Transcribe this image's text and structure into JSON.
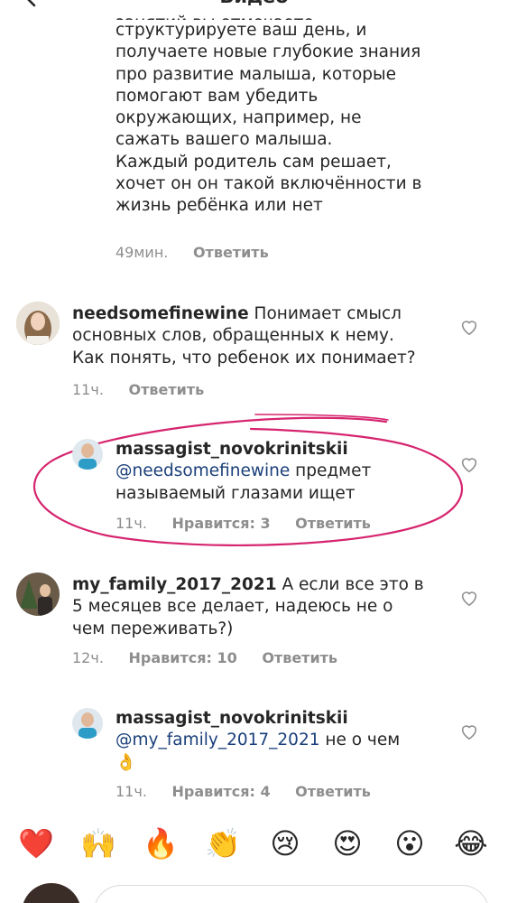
{
  "header": {
    "title": "Видео"
  },
  "previous_comment": {
    "lines": [
      "занятий вы отмечаете",
      "структурируете ваш день, и",
      "получаете новые глубокие знания",
      "про развитие малыша, которые",
      "помогают вам убедить",
      "окружающих, например, не",
      "сажать вашего малыша.",
      "Каждый родитель сам решает,",
      "хочет он он такой включённости в",
      "жизнь ребёнка или нет"
    ],
    "time": "49мин.",
    "reply": "Ответить"
  },
  "comments": [
    {
      "user": "needsomefinewine",
      "lines": [
        "Понимает смысл",
        "основных слов, обращенных к нему.",
        "Как понять, что ребенок их понимает?"
      ],
      "time": "11ч.",
      "reply": "Ответить"
    },
    {
      "user": "massagist_novokrinitskii",
      "mention": "@needsomefinewine",
      "lines": [
        "предмет",
        "называемый глазами ищет"
      ],
      "time": "11ч.",
      "likes": "Нравится: 3",
      "reply": "Ответить"
    },
    {
      "user": "my_family_2017_2021",
      "lines": [
        "А если все это в",
        "5 месяцев все делает, надеюсь не о",
        "чем переживать?)"
      ],
      "time": "12ч.",
      "likes": "Нравится: 10",
      "reply": "Ответить"
    },
    {
      "user": "massagist_novokrinitskii",
      "mention": "@my_family_2017_2021",
      "lines": [
        "не о чем",
        "👌"
      ],
      "time": "11ч.",
      "likes": "Нравится: 4",
      "reply": "Ответить"
    }
  ],
  "reactions": [
    "❤️",
    "🙌",
    "🔥",
    "👏",
    "😢",
    "😍",
    "😮",
    "😂"
  ],
  "colors": {
    "mention": "#1a3f7a",
    "meta": "#8e8e8e",
    "highlight": "#d6246e"
  },
  "icons": [
    "back-chevron-icon",
    "heart-outline-icon"
  ]
}
